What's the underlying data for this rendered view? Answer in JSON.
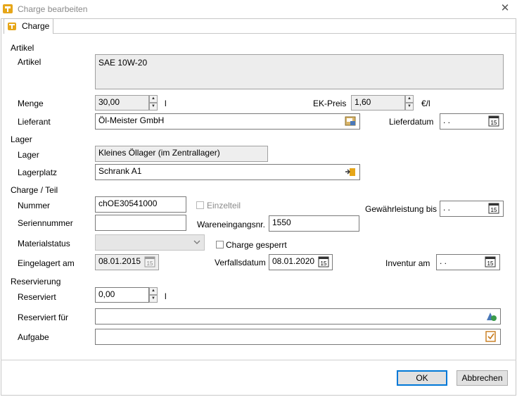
{
  "window": {
    "title": "Charge bearbeiten",
    "close": "✕"
  },
  "tab": {
    "label": "Charge"
  },
  "sections": {
    "artikel": "Artikel",
    "lager": "Lager",
    "charge": "Charge / Teil",
    "reservierung": "Reservierung"
  },
  "labels": {
    "artikel": "Artikel",
    "menge": "Menge",
    "menge_unit": "l",
    "ek_preis": "EK-Preis",
    "ek_unit": "€/l",
    "lieferant": "Lieferant",
    "lieferdatum": "Lieferdatum",
    "lager": "Lager",
    "lagerplatz": "Lagerplatz",
    "nummer": "Nummer",
    "einzelteil": "Einzelteil",
    "gewaehrleistung": "Gewährleistung bis",
    "seriennummer": "Seriennummer",
    "wareneingangsnr": "Wareneingangsnr.",
    "materialstatus": "Materialstatus",
    "charge_gesperrt": "Charge gesperrt",
    "eingelagert": "Eingelagert am",
    "verfallsdatum": "Verfallsdatum",
    "inventur": "Inventur am",
    "reserviert": "Reserviert",
    "reserviert_unit": "l",
    "reserviert_fuer": "Reserviert für",
    "aufgabe": "Aufgabe"
  },
  "values": {
    "artikel": "SAE 10W-20",
    "menge": "30,00",
    "ek_preis": "1,60",
    "lieferant": "Öl-Meister GmbH",
    "lieferdatum": " .  .",
    "lager": "Kleines Öllager (im Zentrallager)",
    "lagerplatz": "Schrank A1",
    "nummer": "chOE30541000",
    "gewaehrleistung": " .  .",
    "seriennummer": "",
    "wareneingangsnr": "1550",
    "materialstatus": "",
    "eingelagert": "08.01.2015",
    "verfallsdatum": "08.01.2020",
    "inventur": " .  .",
    "reserviert": "0,00",
    "reserviert_fuer": "",
    "aufgabe": ""
  },
  "checkboxes": {
    "einzelteil": false,
    "charge_gesperrt": false
  },
  "buttons": {
    "ok": "OK",
    "cancel": "Abbrechen"
  }
}
